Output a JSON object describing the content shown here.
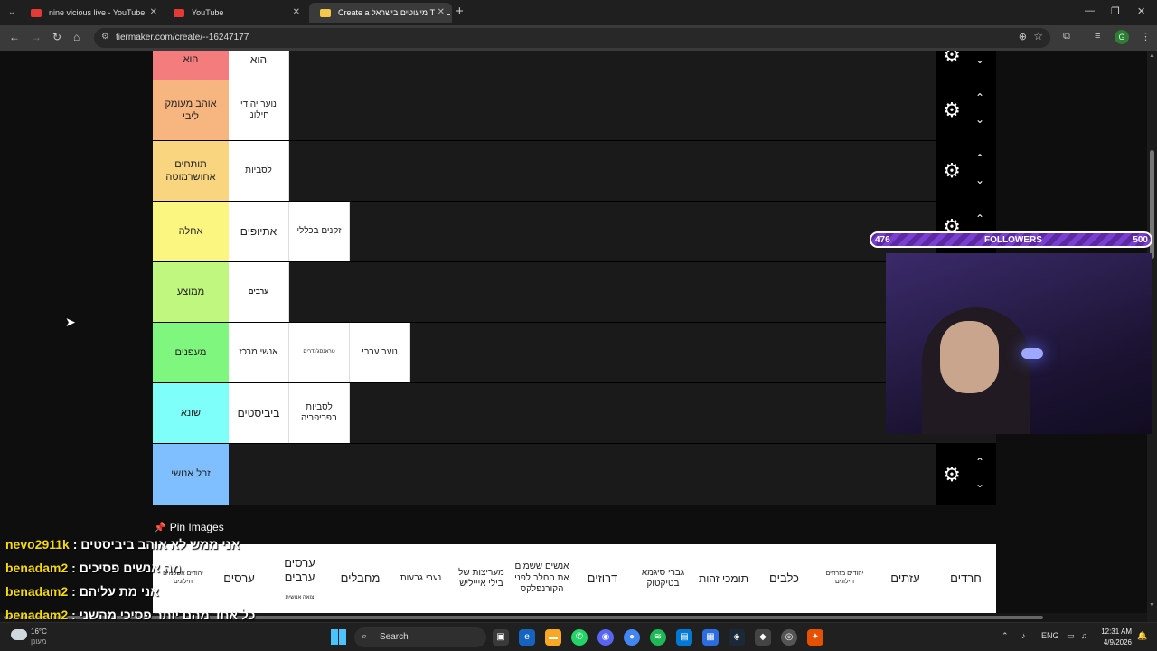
{
  "browser": {
    "tabs": [
      {
        "title": "nine vicious live - YouTube",
        "favicon": "youtube-icon",
        "active": false
      },
      {
        "title": "YouTube",
        "favicon": "youtube-icon",
        "active": false
      },
      {
        "title": "Create a מיעוטים בישראל Tier L",
        "favicon": "tiermaker-icon",
        "active": true
      }
    ],
    "url": "tiermaker.com/create/--16247177",
    "profile_initial": "G"
  },
  "tiers": [
    {
      "label": "הוא",
      "color": "#f47c7c",
      "items": [
        "הוא"
      ]
    },
    {
      "label": "אוהב מעומק ליבי",
      "color": "#f7b57f",
      "items": [
        "נוער יהודי חילוני"
      ]
    },
    {
      "label": "תותחים אחושרמוטה",
      "color": "#f9d57f",
      "items": [
        "לסביות"
      ]
    },
    {
      "label": "אחלה",
      "color": "#fbf67f",
      "items": [
        "אתיופים",
        "זקנים בכללי"
      ]
    },
    {
      "label": "ממוצע",
      "color": "#bff77f",
      "items": [
        "ערבים"
      ]
    },
    {
      "label": "מעפנים",
      "color": "#7ff77f",
      "items": [
        "אנשי מרכז",
        "טראנסג'נדרים",
        "נוער ערבי"
      ]
    },
    {
      "label": "שונא",
      "color": "#7ffffa",
      "items": [
        "ביביסטים",
        "לסביות בפריפריה"
      ]
    },
    {
      "label": "זבל אנושי",
      "color": "#7fbfff",
      "items": []
    }
  ],
  "pin_images_label": "Pin Images",
  "image_bank": [
    {
      "text": "חרדים"
    },
    {
      "text": "עזתים"
    },
    {
      "text": "יהודים מזרחים חילונים"
    },
    {
      "text": "כלבים"
    },
    {
      "text": "תומכי זהות"
    },
    {
      "text": "גברי סיגמא בטיקטוק"
    },
    {
      "text": "דרוזים"
    },
    {
      "text": "אנשים ששמים את החלב לפני הקורנפלקס"
    },
    {
      "text": "מעריצות של בילי איייליש"
    },
    {
      "text": "נערי גבעות"
    },
    {
      "text": "מחבלים"
    },
    {
      "text": "ערסים ערבים",
      "sub": "צואה אנושית"
    },
    {
      "text": "ערסים"
    },
    {
      "text": "יהודים אשכנזים חילונים"
    }
  ],
  "chat": [
    {
      "user": "nevo2911k",
      "msg": ": אני ממש לא אוהב ביביסטים"
    },
    {
      "user": "benadam2",
      "msg": ": מה אנשים פסיכים"
    },
    {
      "user": "benadam2",
      "msg": ": אני מת עליהם"
    },
    {
      "user": "benadam2",
      "msg": ": כל אחד מהם יותר פסיכי מהשני"
    }
  ],
  "followers": {
    "current": "476",
    "label": "FOLLOWERS",
    "goal": "500",
    "progress": 0.952
  },
  "taskbar": {
    "weather_temp": "16°C",
    "weather_cond": "מעונן",
    "search_placeholder": "Search",
    "lang": "ENG",
    "time": "12:31 AM",
    "date": "4/9/2026"
  }
}
